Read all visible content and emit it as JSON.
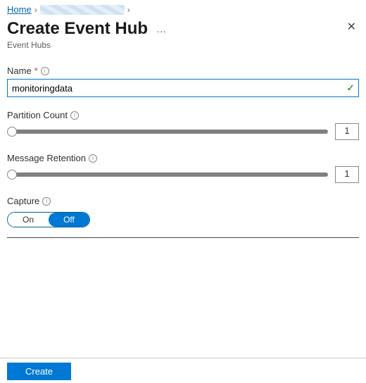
{
  "breadcrumb": {
    "home": "Home"
  },
  "header": {
    "title": "Create Event Hub",
    "subtitle": "Event Hubs"
  },
  "fields": {
    "name": {
      "label": "Name",
      "value": "monitoringdata"
    },
    "partition": {
      "label": "Partition Count",
      "value": "1"
    },
    "retention": {
      "label": "Message Retention",
      "value": "1"
    },
    "capture": {
      "label": "Capture",
      "option_on": "On",
      "option_off": "Off",
      "selected": "Off"
    }
  },
  "footer": {
    "create": "Create"
  }
}
